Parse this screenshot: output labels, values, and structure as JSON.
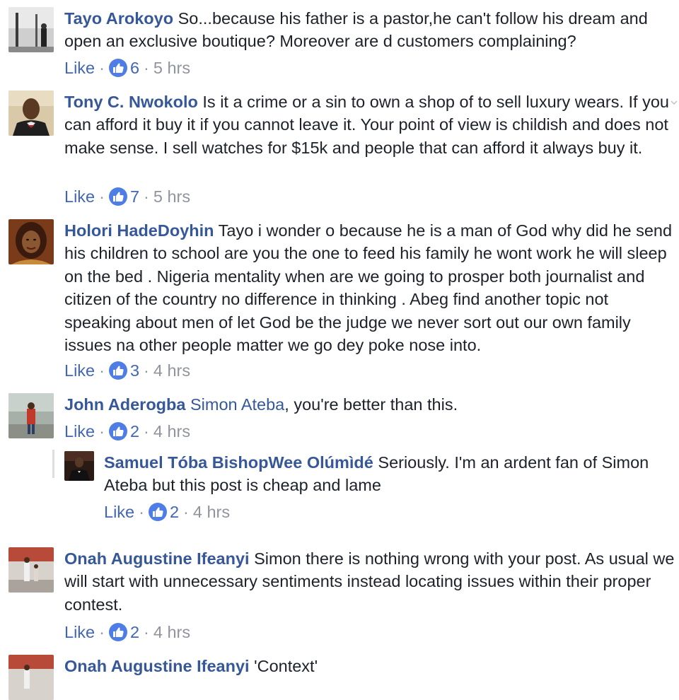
{
  "ui": {
    "like_label": "Like",
    "separator": "·"
  },
  "comments": [
    {
      "author": "Tayo Arokoyo",
      "text": "So...because his father is a pastor,he can't follow his dream and open an exclusive boutique? Moreover are d customers complaining?",
      "likes": "6",
      "time": "5 hrs"
    },
    {
      "author": "Tony C. Nwokolo",
      "text": "Is it a crime or a sin to own a shop of to sell luxury wears. If you can afford it buy it if you cannot leave it. Your point of view is childish and does not make sense. I sell watches for $15k and people that can afford it always buy it.",
      "likes": "7",
      "time": "5 hrs"
    },
    {
      "author": "Holori HadeDoyhin",
      "text": "Tayo i wonder o because he is a man of God why did he send his children to school are you the one to feed his family he wont work he will sleep on the bed . Nigeria mentality when are we going to prosper both journalist and citizen of the country no difference in thinking . Abeg find another topic not speaking about men of let God be the judge we never sort out our own family issues na other people matter we go dey poke nose into.",
      "likes": "3",
      "time": "4 hrs"
    },
    {
      "author": "John Aderogba",
      "mention": "Simon Ateba",
      "text": ", you're better than this.",
      "likes": "2",
      "time": "4 hrs"
    },
    {
      "author": "Samuel Tóba BishopWee Olúmìdé",
      "text": "Seriously. I'm an ardent fan of Simon Ateba but this post is cheap and lame",
      "likes": "2",
      "time": "4 hrs"
    },
    {
      "author": "Onah Augustine Ifeanyi",
      "text": "Simon there is nothing wrong with your post. As usual we will start with unnecessary sentiments instead locating issues within their proper contest.",
      "likes": "2",
      "time": "4 hrs"
    },
    {
      "author": "Onah Augustine Ifeanyi",
      "text": "'Context'"
    }
  ],
  "colors": {
    "author": "#365899",
    "like_link": "#4267b2",
    "meta": "#90949c",
    "like_badge": "#4f7de6"
  },
  "icons": {
    "like_badge": "thumbs-up-icon",
    "options": "chevron-down-icon"
  }
}
